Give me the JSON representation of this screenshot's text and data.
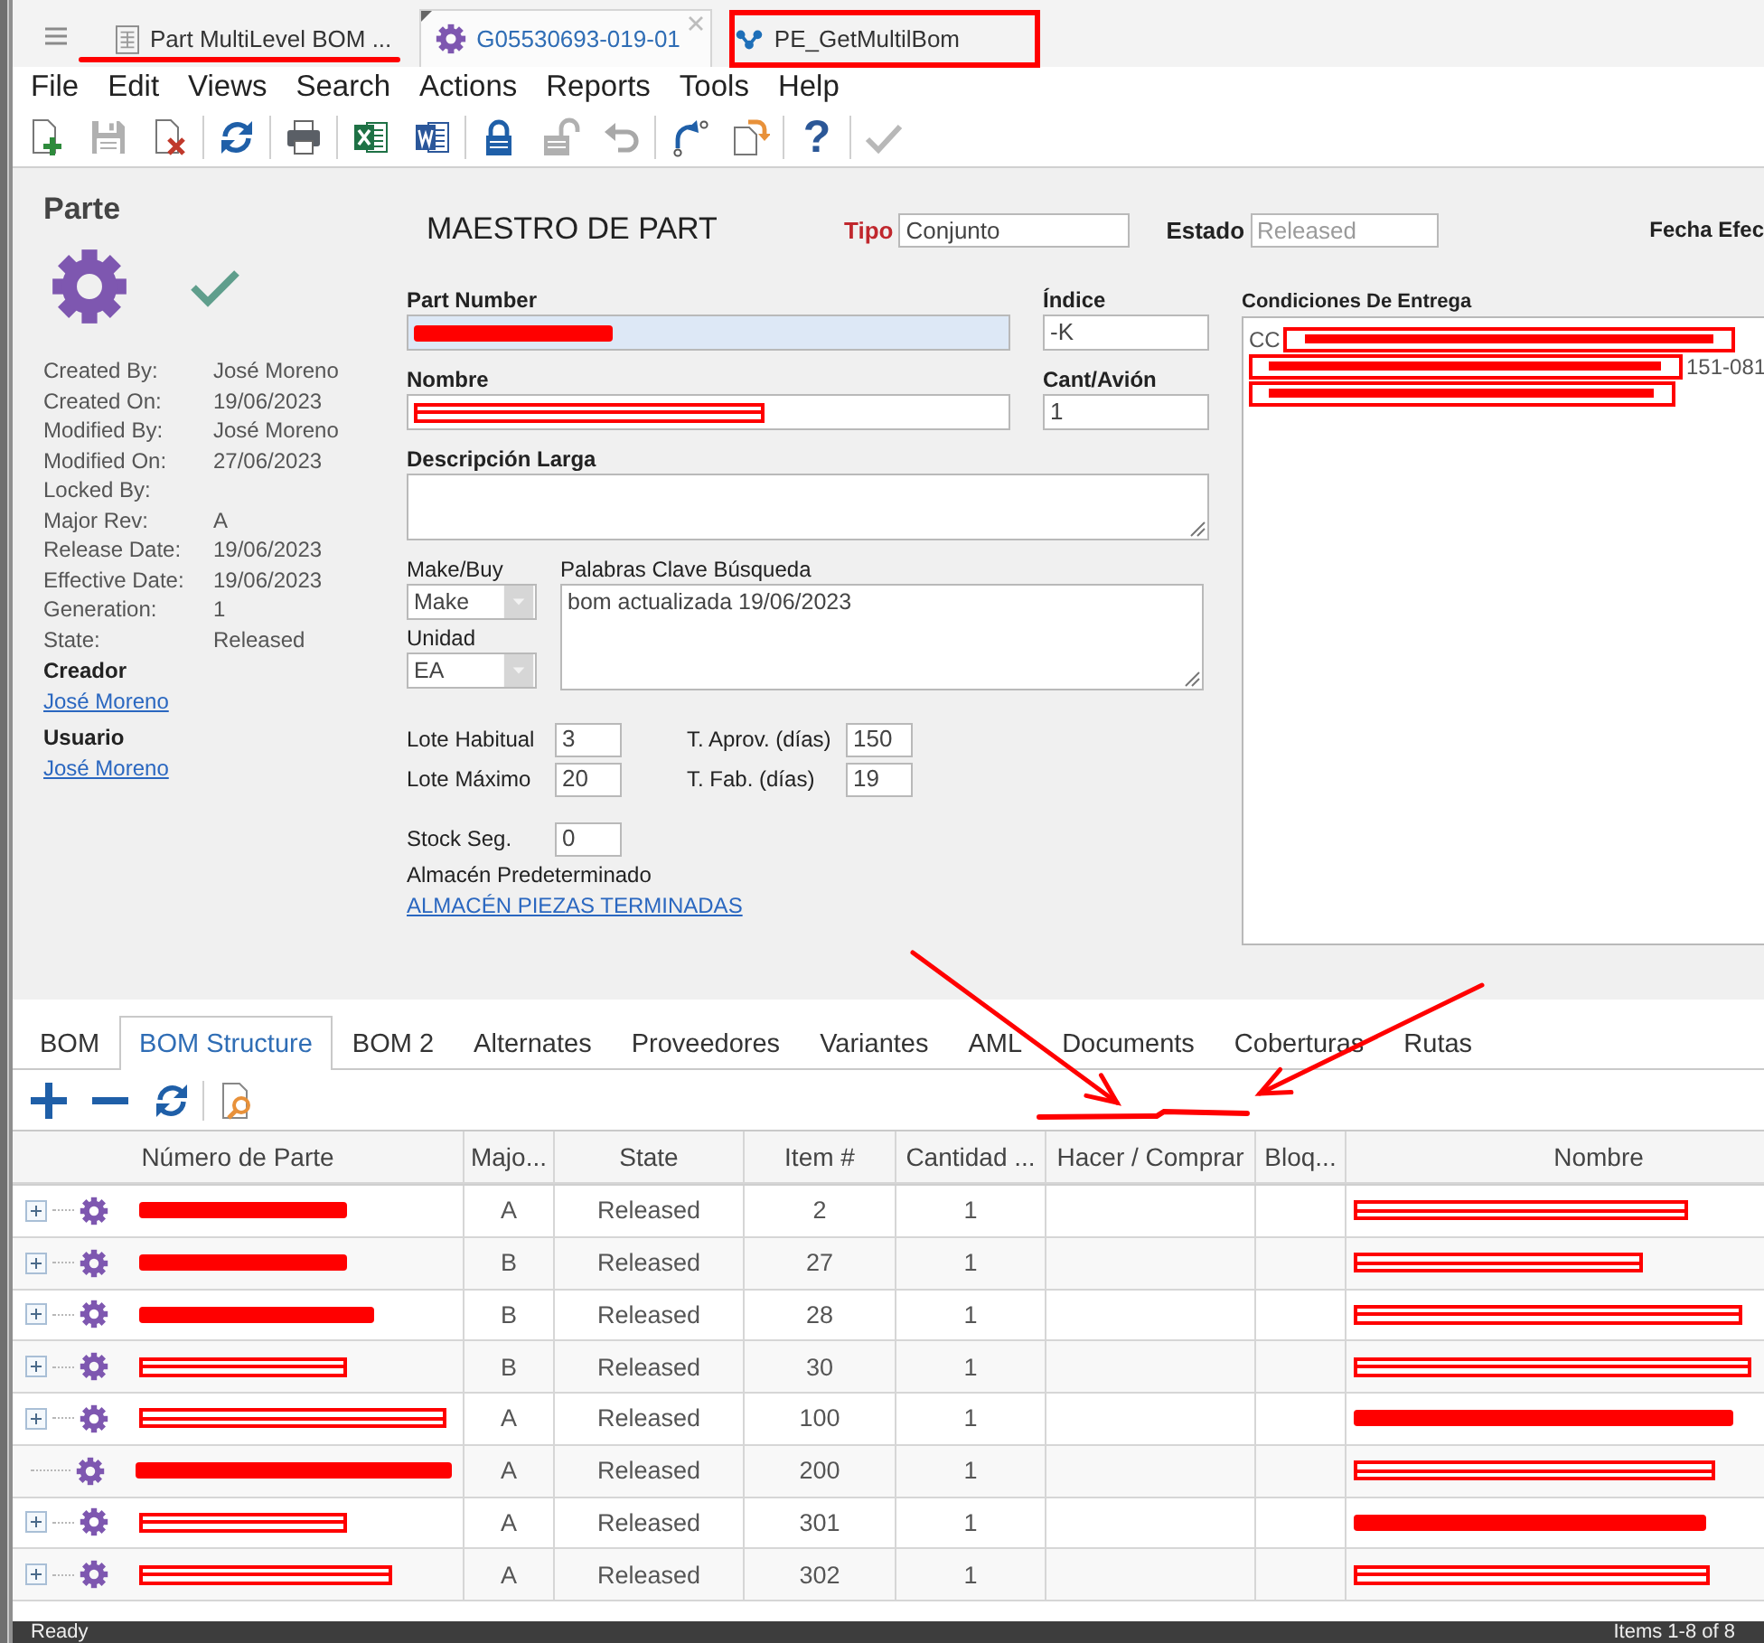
{
  "tabs": [
    {
      "label": "Part MultiLevel BOM ...",
      "kind": "report",
      "selected": false,
      "closable": false
    },
    {
      "label": "G05530693-019-01",
      "kind": "part",
      "selected": true,
      "closable": true
    },
    {
      "label": "PE_GetMultilBom",
      "kind": "workflow",
      "selected": false,
      "closable": false
    }
  ],
  "menu": [
    "File",
    "Edit",
    "Views",
    "Search",
    "Actions",
    "Reports",
    "Tools",
    "Help"
  ],
  "toolbar": [
    {
      "items": [
        {
          "kind": "new",
          "disabled": false
        },
        {
          "kind": "save",
          "disabled": true
        },
        {
          "kind": "delete",
          "disabled": false
        }
      ]
    },
    {
      "items": [
        {
          "kind": "refresh",
          "disabled": false
        }
      ]
    },
    {
      "items": [
        {
          "kind": "print",
          "disabled": false
        }
      ]
    },
    {
      "items": [
        {
          "kind": "excel",
          "disabled": false
        },
        {
          "kind": "word",
          "disabled": false
        }
      ]
    },
    {
      "items": [
        {
          "kind": "lock",
          "disabled": false
        },
        {
          "kind": "unlock",
          "disabled": true
        },
        {
          "kind": "undo",
          "disabled": true
        }
      ]
    },
    {
      "items": [
        {
          "kind": "flow",
          "disabled": false
        },
        {
          "kind": "export",
          "disabled": false
        }
      ]
    },
    {
      "items": [
        {
          "kind": "help",
          "glyph": "?",
          "disabled": false
        }
      ]
    },
    {
      "items": [
        {
          "kind": "done",
          "disabled": true
        }
      ]
    }
  ],
  "part": {
    "title": "Parte",
    "properties": [
      {
        "label": "Created By:",
        "value": "José Moreno"
      },
      {
        "label": "Created On:",
        "value": "19/06/2023"
      },
      {
        "label": "Modified By:",
        "value": "José Moreno"
      },
      {
        "label": "Modified On:",
        "value": "27/06/2023"
      },
      {
        "label": "Locked By:"
      },
      {
        "label": "Major Rev:",
        "value": "A"
      },
      {
        "label": "Release Date:",
        "value": "19/06/2023"
      },
      {
        "label": "Effective Date:",
        "value": "19/06/2023"
      },
      {
        "label": "Generation:",
        "value": "1"
      },
      {
        "label": "State:",
        "value": "Released"
      }
    ],
    "creator": {
      "label": "Creador",
      "name": "José Moreno"
    },
    "user": {
      "label": "Usuario",
      "name": "José Moreno"
    }
  },
  "form": {
    "title": "MAESTRO DE PART",
    "tipo": {
      "label": "Tipo",
      "value": "Conjunto",
      "required": true
    },
    "estado": {
      "label": "Estado",
      "value": "Released",
      "disabled": true
    },
    "fecha_label": "Fecha Efec",
    "part_number": {
      "label": "Part Number",
      "redacted": true,
      "focused": true
    },
    "indice": {
      "label": "Índice",
      "value": "-K"
    },
    "nombre": {
      "label": "Nombre",
      "redacted": true
    },
    "cant_avion": {
      "label": "Cant/Avión",
      "value": "1"
    },
    "descripcion": {
      "label": "Descripción Larga"
    },
    "make_buy": {
      "label": "Make/Buy",
      "value": "Make"
    },
    "unidad": {
      "label": "Unidad",
      "value": "EA"
    },
    "keywords": {
      "label": "Palabras Clave Búsqueda",
      "value": "bom actualizada 19/06/2023"
    },
    "lot_rows": [
      {
        "fields": [
          {
            "label": "Lote Habitual",
            "value": "3"
          },
          {
            "label": "T. Aprov. (días)",
            "value": "150"
          }
        ]
      },
      {
        "fields": [
          {
            "label": "Lote Máximo",
            "value": "20"
          },
          {
            "label": "T. Fab. (días)",
            "value": "19"
          }
        ]
      },
      {
        "fields": [
          {
            "label": "Stock Seg.",
            "value": "0"
          }
        ]
      }
    ],
    "warehouse": {
      "label": "Almacén Predeterminado",
      "link": "ALMACÉN PIEZAS TERMINADAS"
    },
    "delivery": {
      "label": "Condiciones De Entrega",
      "lines": [
        {
          "lead": "CC",
          "redacted": true
        },
        {
          "tail": "151-081",
          "redacted": true
        },
        {
          "redacted": true
        }
      ]
    }
  },
  "detail_tabs": [
    {
      "label": "BOM",
      "selected": false
    },
    {
      "label": "BOM Structure",
      "selected": true
    },
    {
      "label": "BOM 2",
      "selected": false
    },
    {
      "label": "Alternates",
      "selected": false
    },
    {
      "label": "Proveedores",
      "selected": false
    },
    {
      "label": "Variantes",
      "selected": false
    },
    {
      "label": "AML",
      "selected": false
    },
    {
      "label": "Documents",
      "selected": false
    },
    {
      "label": "Coberturas",
      "selected": false
    },
    {
      "label": "Rutas",
      "selected": false
    }
  ],
  "grid_toolbar": [
    {
      "items": [
        {
          "kind": "add"
        },
        {
          "kind": "remove"
        },
        {
          "kind": "refresh"
        }
      ]
    },
    {
      "items": [
        {
          "kind": "find"
        }
      ]
    }
  ],
  "grid": {
    "columns": [
      "Número de Parte",
      "Majo...",
      "State",
      "Item #",
      "Cantidad ...",
      "Hacer / Comprar",
      "Bloq...",
      "Nombre"
    ],
    "rows": [
      {
        "has_children": true,
        "part_number_redacted": true,
        "major": "A",
        "state": "Released",
        "item": "2",
        "quantity": "1",
        "name_redacted": true
      },
      {
        "has_children": true,
        "part_number_redacted": true,
        "major": "B",
        "state": "Released",
        "item": "27",
        "quantity": "1",
        "name_redacted": true
      },
      {
        "has_children": true,
        "part_number_redacted": true,
        "major": "B",
        "state": "Released",
        "item": "28",
        "quantity": "1",
        "name_redacted": true
      },
      {
        "has_children": true,
        "part_number_redacted": true,
        "major": "B",
        "state": "Released",
        "item": "30",
        "quantity": "1",
        "name_redacted": true
      },
      {
        "has_children": true,
        "part_number_redacted": true,
        "major": "A",
        "state": "Released",
        "item": "100",
        "quantity": "1",
        "name_redacted": true
      },
      {
        "has_children": false,
        "part_number_redacted": true,
        "major": "A",
        "state": "Released",
        "item": "200",
        "quantity": "1",
        "name_redacted": true
      },
      {
        "has_children": true,
        "part_number_redacted": true,
        "major": "A",
        "state": "Released",
        "item": "301",
        "quantity": "1",
        "name_redacted": true
      },
      {
        "has_children": true,
        "part_number_redacted": true,
        "major": "A",
        "state": "Released",
        "item": "302",
        "quantity": "1",
        "name_redacted": true
      }
    ]
  },
  "status_bar": {
    "left": "Ready",
    "right": "Items 1-8 of 8"
  },
  "annotations": [
    {
      "kind": "underline"
    },
    {
      "kind": "box"
    },
    {
      "kind": "arrow"
    },
    {
      "kind": "arrow"
    },
    {
      "kind": "squiggle"
    }
  ]
}
